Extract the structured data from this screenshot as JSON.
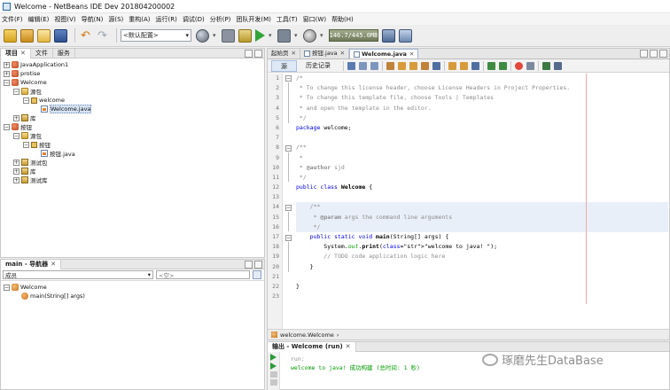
{
  "window": {
    "title": "Welcome - NetBeans IDE Dev 201804200002"
  },
  "menu": [
    "文件(F)",
    "编辑(E)",
    "视图(V)",
    "导航(N)",
    "源(S)",
    "重构(A)",
    "运行(R)",
    "调试(D)",
    "分析(P)",
    "团队开发(M)",
    "工具(T)",
    "窗口(W)",
    "帮助(H)"
  ],
  "toolbar": {
    "config": "<默认配置>",
    "memory": "146.7/445.0MB"
  },
  "projects": {
    "tabs": [
      {
        "label": "项目"
      },
      {
        "label": "文件"
      },
      {
        "label": "服务"
      }
    ],
    "tree": [
      {
        "label": "JavaApplication1",
        "icon": "project-icon",
        "level": 0,
        "toggle": "+"
      },
      {
        "label": "protise",
        "icon": "project-icon",
        "level": 0,
        "toggle": "+"
      },
      {
        "label": "Welcome",
        "icon": "project-icon",
        "level": 0,
        "toggle": "-"
      },
      {
        "label": "源包",
        "icon": "package-folder-icon",
        "level": 1,
        "toggle": "-"
      },
      {
        "label": "welcome",
        "icon": "package-icon",
        "level": 2,
        "toggle": "-"
      },
      {
        "label": "Welcome.java",
        "icon": "java-file-icon",
        "level": 3,
        "toggle": "",
        "selected": true
      },
      {
        "label": "库",
        "icon": "library-icon",
        "level": 1,
        "toggle": "+"
      },
      {
        "label": "按钮",
        "icon": "project-icon",
        "level": 0,
        "toggle": "-"
      },
      {
        "label": "源包",
        "icon": "package-folder-icon",
        "level": 1,
        "toggle": "-"
      },
      {
        "label": "按钮",
        "icon": "package-icon",
        "level": 2,
        "toggle": "-"
      },
      {
        "label": "按钮.java",
        "icon": "java-file-icon",
        "level": 3,
        "toggle": ""
      },
      {
        "label": "测试包",
        "icon": "test-folder-icon",
        "level": 1,
        "toggle": "+"
      },
      {
        "label": "库",
        "icon": "library-icon",
        "level": 1,
        "toggle": "+"
      },
      {
        "label": "测试库",
        "icon": "test-folder-icon",
        "level": 1,
        "toggle": "+"
      }
    ]
  },
  "navigator": {
    "tab": "main - 导航器",
    "filter": "成员",
    "filter_search": "<空>",
    "tree": [
      {
        "label": "Welcome",
        "icon": "class-icon",
        "level": 0,
        "toggle": "-"
      },
      {
        "label": "main(String[] args)",
        "icon": "method-icon",
        "level": 1,
        "toggle": ""
      }
    ]
  },
  "editor": {
    "tabs": [
      {
        "label": "起始页"
      },
      {
        "label": "按钮.java"
      },
      {
        "label": "Welcome.java",
        "active": true
      }
    ],
    "views": [
      "源",
      "历史记录"
    ],
    "line_numbers": [
      "1",
      "2",
      "3",
      "4",
      "5",
      "6",
      "7",
      "8",
      "9",
      "10",
      "11",
      "12",
      "13",
      "14",
      "15",
      "16",
      "17",
      "18",
      "19",
      "20",
      "21",
      "22",
      "23"
    ],
    "code": [
      "/*",
      " * To change this license header, choose License Headers in Project Properties.",
      " * To change this template file, choose Tools | Templates",
      " * and open the template in the editor.",
      " */",
      "package welcome;",
      "",
      "/**",
      " *",
      " * @author sjd",
      " */",
      "public class Welcome {",
      "",
      "    /**",
      "     * @param args the command line arguments",
      "     */",
      "    public static void main(String[] args) {",
      "        System.out.print(\"welcome to java! \");",
      "        // TODO code application logic here",
      "    }",
      "",
      "}",
      ""
    ],
    "breadcrumb": "welcome.Welcome"
  },
  "output": {
    "tab": "输出 - Welcome (run)",
    "lines": [
      "run:",
      "welcome to java! 成功构建 (总时间: 1 秒)"
    ]
  },
  "watermark": "琢磨先生DataBase"
}
